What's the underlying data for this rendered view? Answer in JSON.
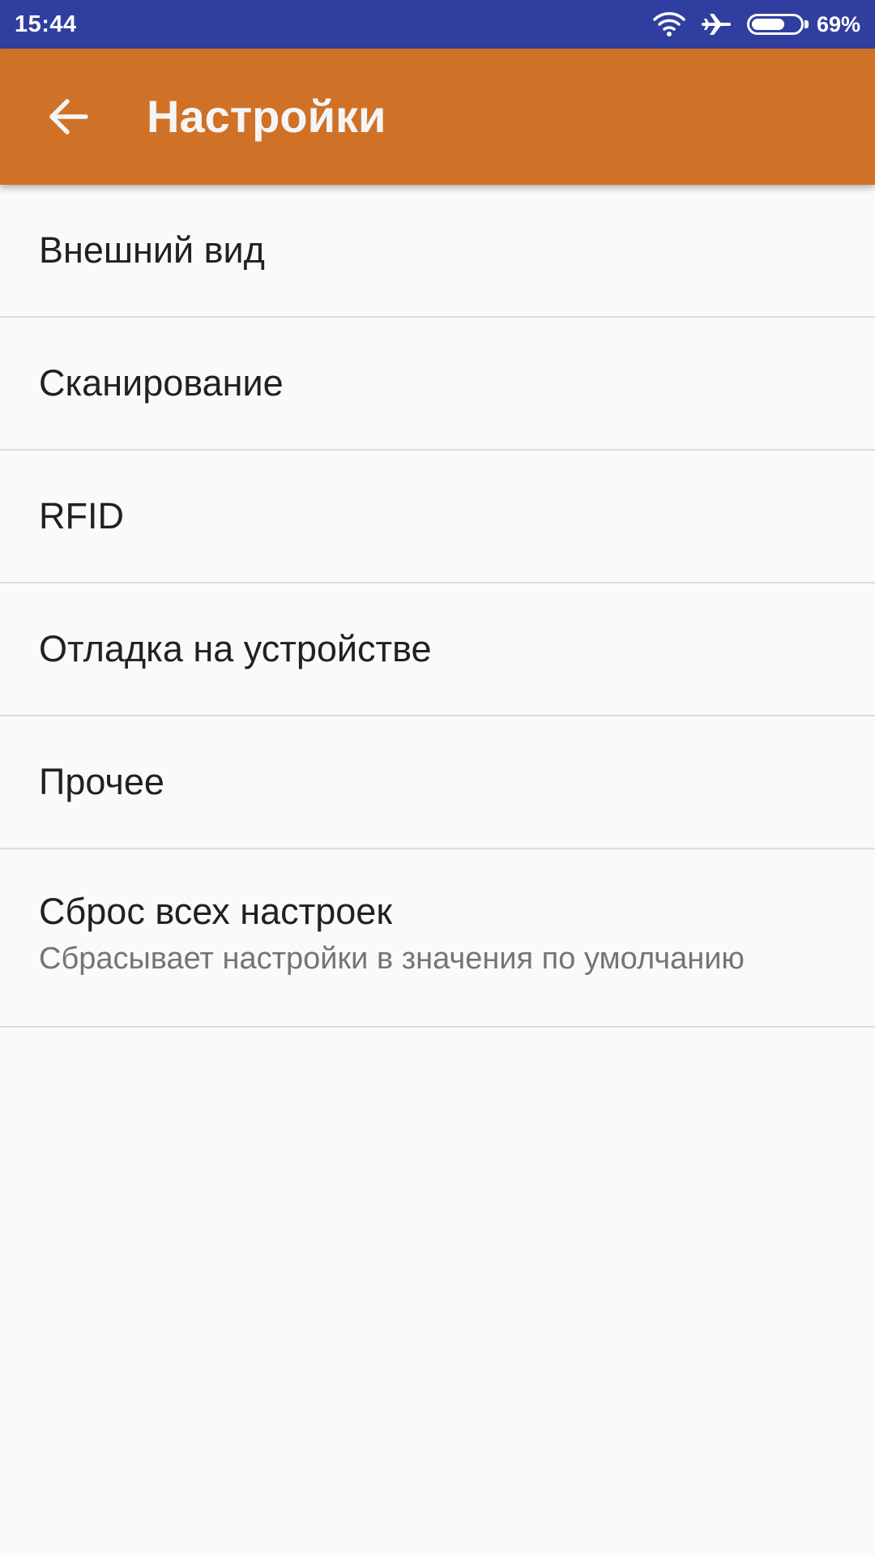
{
  "status_bar": {
    "time": "15:44",
    "icons": [
      "wifi-icon",
      "airplane-icon",
      "battery-icon"
    ],
    "battery_level": 0.69,
    "battery_percent": "69%",
    "background_color": "#303f9f"
  },
  "app_bar": {
    "title": "Настройки",
    "back_icon": "arrow-back-icon",
    "background_color": "#d07128"
  },
  "settings": {
    "items": [
      {
        "title": "Внешний вид"
      },
      {
        "title": "Сканирование"
      },
      {
        "title": "RFID"
      },
      {
        "title": "Отладка на устройстве"
      },
      {
        "title": "Прочее"
      },
      {
        "title": "Сброс всех настроек",
        "summary": "Сбрасывает настройки в значения по умолчанию"
      }
    ]
  }
}
